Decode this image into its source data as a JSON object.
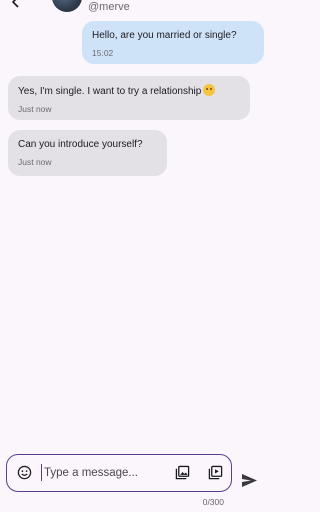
{
  "header": {
    "username": "@merve",
    "back_icon": "arrow-back-icon",
    "menu_icon": "more-vert-icon"
  },
  "messages": [
    {
      "direction": "outgoing",
      "text": "Hello, are you married or single?",
      "time": "15:02"
    },
    {
      "direction": "incoming",
      "text": "Yes, I'm single. I want to try a relationship",
      "emoji": "smiling-face-icon",
      "time": "Just now"
    },
    {
      "direction": "incoming",
      "text": "Can you introduce yourself?",
      "time": "Just now"
    }
  ],
  "composer": {
    "placeholder": "Type a message...",
    "value": "",
    "counter": "0/300",
    "icons": [
      "emoji-icon",
      "gallery-icon",
      "video-icon",
      "send-icon"
    ]
  },
  "colors": {
    "background": "#fbf6fb",
    "outgoing_bubble": "#cfe3f8",
    "incoming_bubble": "#e3e1e6",
    "accent": "#5a3e8d"
  }
}
